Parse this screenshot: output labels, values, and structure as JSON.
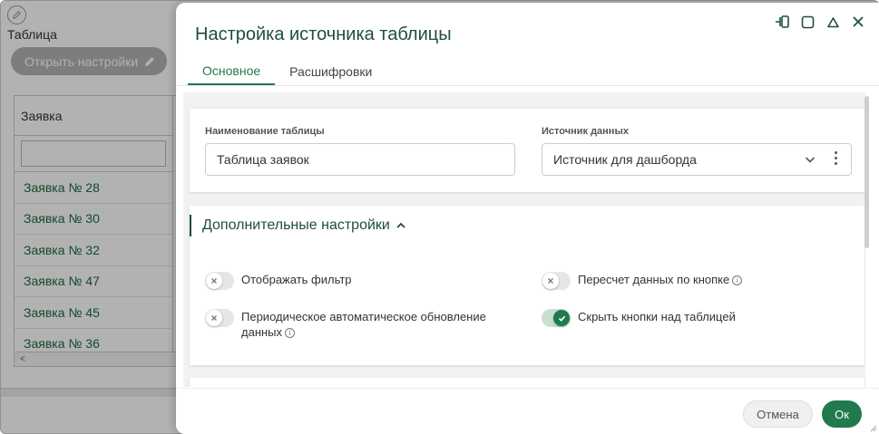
{
  "background": {
    "title": "Таблица",
    "open_settings_label": "Открыть настройки",
    "table": {
      "column_header": "Заявка",
      "rows": [
        "Заявка № 28",
        "Заявка № 30",
        "Заявка № 32",
        "Заявка № 47",
        "Заявка № 45",
        "Заявка № 36"
      ],
      "scroll_left": "<"
    }
  },
  "modal": {
    "title": "Настройка источника таблицы",
    "tabs": [
      {
        "label": "Основное",
        "active": true
      },
      {
        "label": "Расшифровки",
        "active": false
      }
    ],
    "fields": {
      "table_name": {
        "label": "Наименование таблицы",
        "value": "Таблица заявок"
      },
      "data_source": {
        "label": "Источник данных",
        "value": "Источник для дашборда"
      }
    },
    "advanced": {
      "title": "Дополнительные настройки",
      "expanded": true,
      "toggles": [
        {
          "label": "Отображать фильтр",
          "on": false,
          "info": false
        },
        {
          "label": "Пересчет данных по кнопке",
          "on": false,
          "info": true
        },
        {
          "label": "Периодическое автоматическое обновление данных",
          "on": false,
          "info": true
        },
        {
          "label": "Скрыть кнопки над таблицей",
          "on": true,
          "info": false
        }
      ]
    },
    "footer": {
      "cancel_label": "Отмена",
      "ok_label": "Ок"
    }
  },
  "colors": {
    "accent": "#1f7a4e",
    "title": "#1f4f36",
    "link": "#1e6b40"
  }
}
